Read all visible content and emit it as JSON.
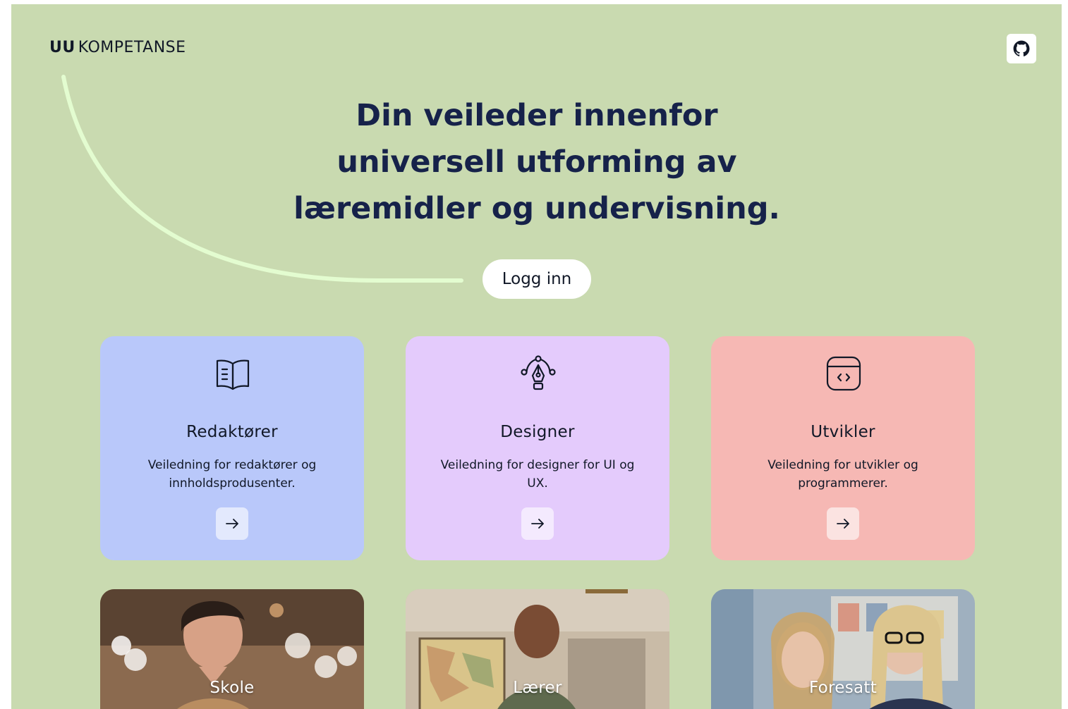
{
  "header": {
    "logo_bold": "UU",
    "logo_rest": "KOMPETANSE",
    "github_icon": "github-icon"
  },
  "hero": {
    "title_line1": "Din veileder innenfor",
    "title_line2": "universell utforming av",
    "title_line3": "læremidler og undervisning."
  },
  "login_label": "Logg inn",
  "cards": [
    {
      "title": "Redaktører",
      "description": "Veiledning for redaktører og innholdsprodusenter.",
      "icon": "open-book-icon",
      "color": "#b9c8fa"
    },
    {
      "title": "Designer",
      "description": "Veiledning for designer for UI og UX.",
      "icon": "pen-tool-icon",
      "color": "#e4cbfc"
    },
    {
      "title": "Utvikler",
      "description": "Veiledning for utvikler og programmerer.",
      "icon": "code-window-icon",
      "color": "#f6b8b4"
    }
  ],
  "audience": [
    {
      "label": "Skole"
    },
    {
      "label": "Lærer"
    },
    {
      "label": "Foresatt"
    }
  ],
  "colors": {
    "background": "#c9dab0",
    "heading": "#16224a",
    "curve": "#e3fcd0"
  }
}
